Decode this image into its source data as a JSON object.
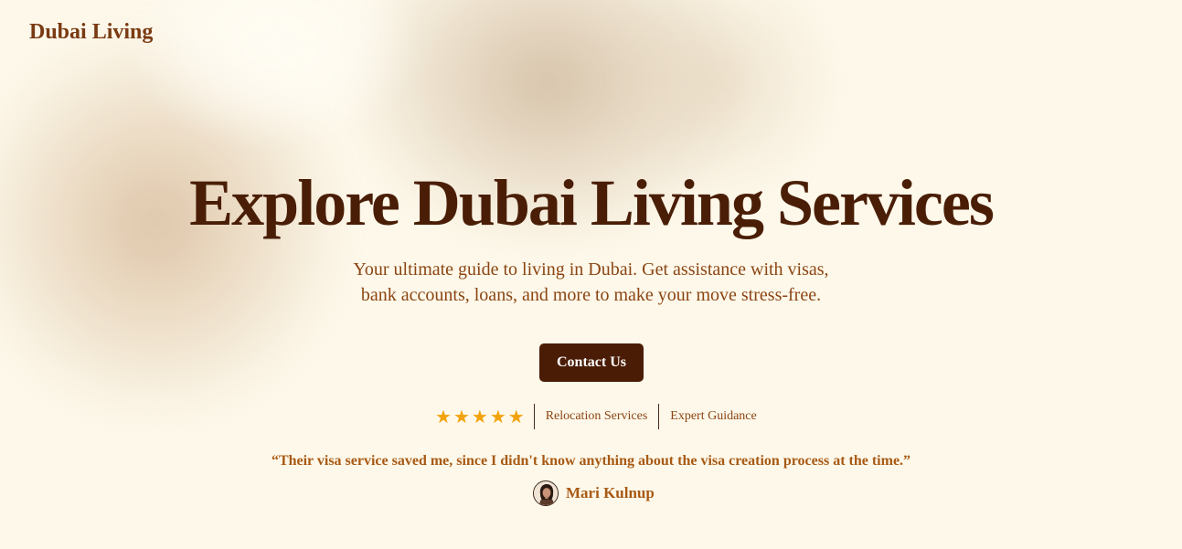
{
  "brand": {
    "logo": "Dubai Living"
  },
  "hero": {
    "title": "Explore Dubai Living Services",
    "subtitle_line1": "Your ultimate guide to living in Dubai. Get assistance with visas,",
    "subtitle_line2": "bank accounts, loans, and more to make your move stress-free.",
    "cta_label": "Contact Us"
  },
  "trust": {
    "rating": 5,
    "star_icon": "star-icon",
    "star_color": "#f2a20c",
    "badges": [
      "Relocation Services",
      "Expert Guidance"
    ]
  },
  "testimonial": {
    "quote": "“Their visa service saved me, since I didn't know anything about the visa creation process at the time.”",
    "author": "Mari Kulnup",
    "avatar_icon": "avatar-portrait"
  },
  "colors": {
    "background": "#fdf8ea",
    "title": "#4a1e06",
    "accent": "#8b4513",
    "button": "#4a1c05",
    "quote": "#a85a14"
  }
}
